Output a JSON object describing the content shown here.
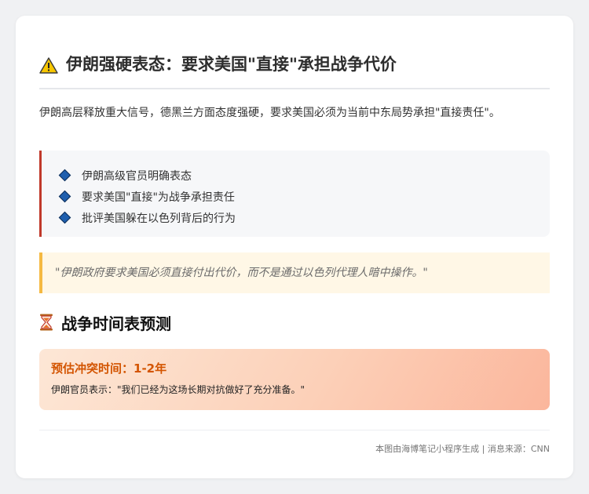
{
  "header": {
    "title": "伊朗强硬表态：要求美国\"直接\"承担战争代价",
    "icon": "warning-icon"
  },
  "intro": "伊朗高层释放重大信号，德黑兰方面态度强硬，要求美国必须为当前中东局势承担\"直接责任\"。",
  "points": [
    "伊朗高级官员明确表态",
    "要求美国\"直接\"为战争承担责任",
    "批评美国躲在以色列背后的行为"
  ],
  "quote": "\"伊朗政府要求美国必须直接付出代价，而不是通过以色列代理人暗中操作。\"",
  "timeline": {
    "section_title": "战争时间表预测",
    "icon": "hourglass-icon",
    "label": "预估冲突时间：1-2年",
    "statement": "伊朗官员表示：\"我们已经为这场长期对抗做好了充分准备。\""
  },
  "footer": "本图由海博笔记小程序生成 | 消息来源：CNN",
  "colors": {
    "accent_border": "#c0392b",
    "quote_border": "#f5b942",
    "timeline_label": "#d35400",
    "diamond": "#1f5fae"
  }
}
